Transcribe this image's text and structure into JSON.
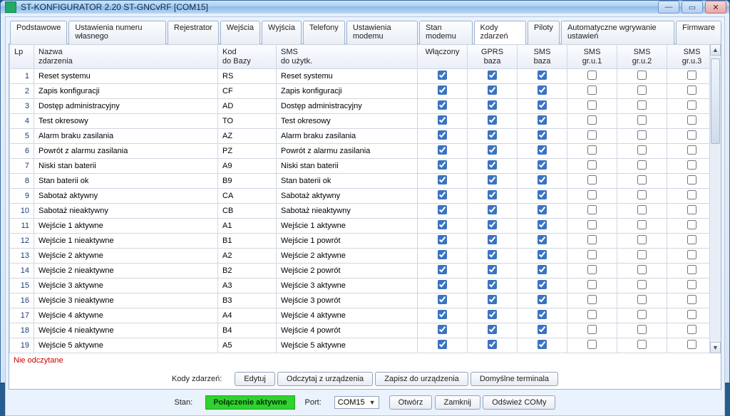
{
  "title": "ST-KONFIGURATOR 2.20 ST-GNCvRF   [COM15]",
  "tabs": [
    "Podstawowe",
    "Ustawienia numeru własnego",
    "Rejestrator",
    "Wejścia",
    "Wyjścia",
    "Telefony",
    "Ustawienia modemu",
    "Stan modemu",
    "Kody zdarzeń",
    "Piloty",
    "Automatyczne wgrywanie ustawień",
    "Firmware"
  ],
  "activeTab": "Kody zdarzeń",
  "headers": {
    "lp": "Lp",
    "name": "Nazwa\nzdarzenia",
    "kod": "Kod\ndo Bazy",
    "sms": "SMS\ndo użytk.",
    "cols": [
      "Włączony",
      "GPRS\nbaza",
      "SMS\nbaza",
      "SMS\ngr.u.1",
      "SMS\ngr.u.2",
      "SMS\ngr.u.3"
    ]
  },
  "rows": [
    {
      "lp": 1,
      "name": "Reset systemu",
      "kod": "RS",
      "sms": "Reset systemu",
      "c": [
        true,
        true,
        true,
        false,
        false,
        false
      ]
    },
    {
      "lp": 2,
      "name": "Zapis konfiguracji",
      "kod": "CF",
      "sms": "Zapis konfiguracji",
      "c": [
        true,
        true,
        true,
        false,
        false,
        false
      ]
    },
    {
      "lp": 3,
      "name": "Dostęp administracyjny",
      "kod": "AD",
      "sms": "Dostęp administracyjny",
      "c": [
        true,
        true,
        true,
        false,
        false,
        false
      ]
    },
    {
      "lp": 4,
      "name": "Test okresowy",
      "kod": "TO",
      "sms": "Test okresowy",
      "c": [
        true,
        true,
        true,
        false,
        false,
        false
      ]
    },
    {
      "lp": 5,
      "name": "Alarm braku zasilania",
      "kod": "AZ",
      "sms": "Alarm braku zasilania",
      "c": [
        true,
        true,
        true,
        false,
        false,
        false
      ]
    },
    {
      "lp": 6,
      "name": "Powrót z alarmu zasilania",
      "kod": "PZ",
      "sms": "Powrót z alarmu zasilania",
      "c": [
        true,
        true,
        true,
        false,
        false,
        false
      ]
    },
    {
      "lp": 7,
      "name": "Niski stan baterii",
      "kod": "A9",
      "sms": "Niski stan baterii",
      "c": [
        true,
        true,
        true,
        false,
        false,
        false
      ]
    },
    {
      "lp": 8,
      "name": "Stan baterii ok",
      "kod": "B9",
      "sms": "Stan baterii ok",
      "c": [
        true,
        true,
        true,
        false,
        false,
        false
      ]
    },
    {
      "lp": 9,
      "name": "Sabotaż aktywny",
      "kod": "CA",
      "sms": "Sabotaż aktywny",
      "c": [
        true,
        true,
        true,
        false,
        false,
        false
      ]
    },
    {
      "lp": 10,
      "name": "Sabotaż nieaktywny",
      "kod": "CB",
      "sms": "Sabotaż nieaktywny",
      "c": [
        true,
        true,
        true,
        false,
        false,
        false
      ]
    },
    {
      "lp": 11,
      "name": "Wejście 1 aktywne",
      "kod": "A1",
      "sms": "Wejście 1 aktywne",
      "c": [
        true,
        true,
        true,
        false,
        false,
        false
      ]
    },
    {
      "lp": 12,
      "name": "Wejście 1 nieaktywne",
      "kod": "B1",
      "sms": "Wejście 1 powrót",
      "c": [
        true,
        true,
        true,
        false,
        false,
        false
      ]
    },
    {
      "lp": 13,
      "name": "Wejście 2 aktywne",
      "kod": "A2",
      "sms": "Wejście 2 aktywne",
      "c": [
        true,
        true,
        true,
        false,
        false,
        false
      ]
    },
    {
      "lp": 14,
      "name": "Wejście 2 nieaktywne",
      "kod": "B2",
      "sms": "Wejście 2 powrót",
      "c": [
        true,
        true,
        true,
        false,
        false,
        false
      ]
    },
    {
      "lp": 15,
      "name": "Wejście 3 aktywne",
      "kod": "A3",
      "sms": "Wejście 3 aktywne",
      "c": [
        true,
        true,
        true,
        false,
        false,
        false
      ]
    },
    {
      "lp": 16,
      "name": "Wejście 3 nieaktywne",
      "kod": "B3",
      "sms": "Wejście 3 powrót",
      "c": [
        true,
        true,
        true,
        false,
        false,
        false
      ]
    },
    {
      "lp": 17,
      "name": "Wejście 4 aktywne",
      "kod": "A4",
      "sms": "Wejście 4 aktywne",
      "c": [
        true,
        true,
        true,
        false,
        false,
        false
      ]
    },
    {
      "lp": 18,
      "name": "Wejście 4 nieaktywne",
      "kod": "B4",
      "sms": "Wejście 4 powrót",
      "c": [
        true,
        true,
        true,
        false,
        false,
        false
      ]
    },
    {
      "lp": 19,
      "name": "Wejście 5 aktywne",
      "kod": "A5",
      "sms": "Wejście 5 aktywne",
      "c": [
        true,
        true,
        true,
        false,
        false,
        false
      ]
    }
  ],
  "statusRed": "Nie odczytane",
  "rowButtons": {
    "label": "Kody zdarzeń:",
    "btns": [
      "Edytuj",
      "Odczytaj z urządzenia",
      "Zapisz do urządzenia",
      "Domyślne terminala"
    ]
  },
  "bottom": {
    "stanLabel": "Stan:",
    "stanValue": "Połączenie aktywne",
    "portLabel": "Port:",
    "portValue": "COM15",
    "btns": [
      "Otwórz",
      "Zamknij",
      "Odśwież COMy"
    ]
  }
}
